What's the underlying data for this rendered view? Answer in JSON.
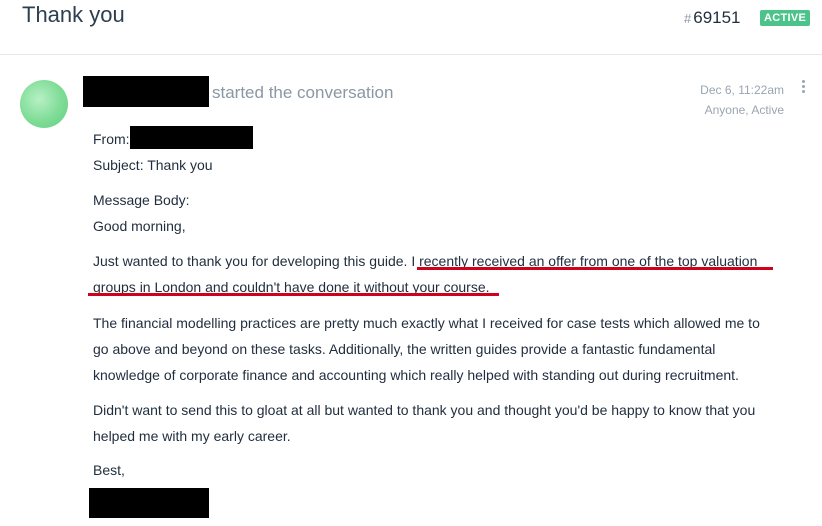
{
  "header": {
    "title": "Thank you",
    "hash": "#",
    "ticket_number": "69151",
    "status": "ACTIVE"
  },
  "conversation": {
    "started_text": "started the conversation",
    "date": "Dec 6, 11:22am",
    "visibility": "Anyone, Active"
  },
  "message": {
    "from_label": "From:",
    "subject": "Subject: Thank you",
    "body_label": "Message Body:",
    "greeting": "Good morning,",
    "p1_line1_start": "Just wanted to thank you for developing this guide.",
    "p1_line1_end": "I recently received an offer from one of the top valuation",
    "p1_line2": "groups in London and couldn't have done it without your course.",
    "p2_line1": "The financial modelling practices are pretty much exactly what I received for case tests which allowed me to",
    "p2_line2": "go above and beyond on these tasks. Additionally, the written guides provide a fantastic fundamental",
    "p2_line3": "knowledge of corporate finance and accounting which really helped with standing out during recruitment.",
    "p3_line1": "Didn't want to send this to gloat at all but wanted to thank you and thought you'd be happy to know that you",
    "p3_line2": "helped me with my early career.",
    "closing": "Best,"
  },
  "colors": {
    "accent_green": "#4cc38a",
    "highlight_red": "#d0021b",
    "muted_text": "#8a97a5"
  }
}
